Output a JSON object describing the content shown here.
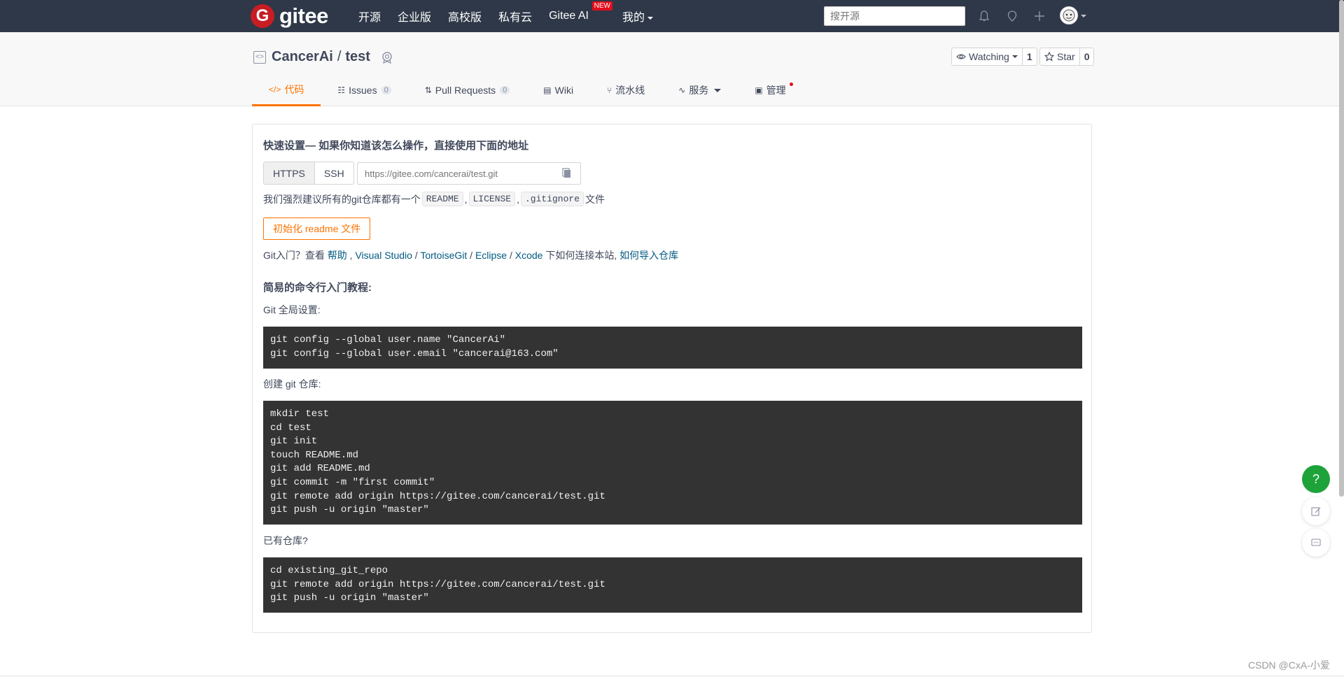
{
  "navbar": {
    "logo_letter": "G",
    "logo_text": "gitee",
    "links": [
      "开源",
      "企业版",
      "高校版",
      "私有云"
    ],
    "gitee_ai": "Gitee AI",
    "new_badge": "NEW",
    "mine": "我的",
    "search_placeholder": "搜开源"
  },
  "repo": {
    "owner": "CancerAi",
    "separator": "/",
    "name": "test",
    "watch_label": "Watching",
    "watch_count": "1",
    "star_label": "Star",
    "star_count": "0"
  },
  "tabs": [
    {
      "label": "代码",
      "icon": "code-icon",
      "active": true
    },
    {
      "label": "Issues",
      "count": "0",
      "icon": "issues-icon"
    },
    {
      "label": "Pull Requests",
      "count": "0",
      "icon": "pull-request-icon"
    },
    {
      "label": "Wiki",
      "icon": "wiki-icon"
    },
    {
      "label": "流水线",
      "icon": "pipeline-icon"
    },
    {
      "label": "服务",
      "icon": "service-icon"
    },
    {
      "label": "管理",
      "icon": "manage-icon"
    }
  ],
  "quick_setup": {
    "title": "快速设置— 如果你知道该怎么操作，直接使用下面的地址",
    "protocols": [
      "HTTPS",
      "SSH"
    ],
    "url_placeholder": "https://gitee.com/cancerai/test.git",
    "recommend_prefix": "我们强烈建议所有的git仓库都有一个",
    "readme": "README",
    "comma1": ",",
    "license": "LICENSE",
    "comma2": ",",
    "gitignore": ".gitignore",
    "recommend_suffix": "文件",
    "init_button": "初始化 readme 文件",
    "intro_prefix": "Git入门？查看 ",
    "help": "帮助",
    "comma": " , ",
    "visual_studio": "Visual Studio",
    "slash1": " / ",
    "tortoisegit": "TortoiseGit",
    "slash2": " / ",
    "eclipse": "Eclipse",
    "slash3": " / ",
    "xcode": "Xcode",
    "intro_middle": " 下如何连接本站, ",
    "import_repo": "如何导入仓库"
  },
  "cli": {
    "title": "简易的命令行入门教程:",
    "global_label": "Git 全局设置:",
    "global_lines": [
      "git config --global user.name \"CancerAi\"",
      "git config --global user.email \"cancerai@163.com\""
    ],
    "create_label": "创建 git 仓库:",
    "create_lines": [
      "mkdir test",
      "cd test",
      "git init",
      "touch README.md",
      "git add README.md",
      "git commit -m \"first commit\"",
      "git remote add origin https://gitee.com/cancerai/test.git",
      "git push -u origin \"master\""
    ],
    "existing_label": "已有仓库?",
    "existing_lines": [
      "cd existing_git_repo",
      "git remote add origin https://gitee.com/cancerai/test.git",
      "git push -u origin \"master\""
    ]
  },
  "floating": {
    "help": "?"
  },
  "watermark": "CSDN @CxA-小爱",
  "colors": {
    "navbar": "#2e3848",
    "accent": "#fe7300",
    "brand_red": "#c71d23",
    "link": "#005980",
    "code_bg": "#333333",
    "help_green": "#1da33a"
  }
}
